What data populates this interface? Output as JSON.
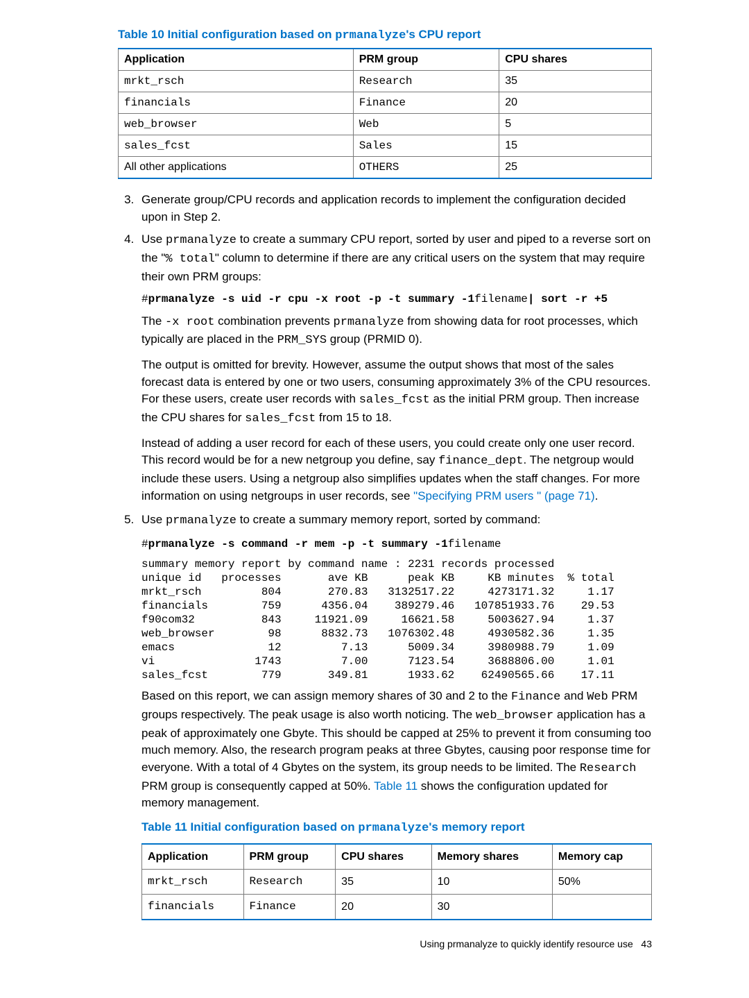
{
  "table10": {
    "title_prefix": "Table 10 Initial configuration based on ",
    "title_mono": "prmanalyze",
    "title_suffix": "'s CPU report",
    "headers": [
      "Application",
      "PRM group",
      "CPU shares"
    ],
    "rows": [
      {
        "app": "mrkt_rsch",
        "group": "Research",
        "shares": "35",
        "mono": true
      },
      {
        "app": "financials",
        "group": "Finance",
        "shares": "20",
        "mono": true
      },
      {
        "app": "web_browser",
        "group": "Web",
        "shares": "5",
        "mono": true
      },
      {
        "app": "sales_fcst",
        "group": "Sales",
        "shares": "15",
        "mono": true
      },
      {
        "app": "All other applications",
        "group": "OTHERS",
        "shares": "25",
        "mono": false
      }
    ]
  },
  "step3": "Generate group/CPU records and application records to implement the configuration decided upon in Step 2.",
  "step4": {
    "intro_a": "Use ",
    "intro_mono1": "prmanalyze",
    "intro_b": " to create a summary CPU report, sorted by user and piped to a reverse sort on the \"",
    "intro_mono2": "% total",
    "intro_c": "\" column to determine if there are any critical users on the system that may require their own PRM groups:",
    "cmd1_a": "#",
    "cmd1_b": "prmanalyze -s uid -r cpu -x root -p -t summary -1",
    "cmd1_c": "filename",
    "cmd1_d": "| sort -r +5",
    "para2_a": "The ",
    "para2_mono1": "-x root",
    "para2_b": " combination prevents ",
    "para2_mono2": "prmanalyze",
    "para2_c": " from showing data for root processes, which typically are placed in the ",
    "para2_mono3": "PRM_SYS",
    "para2_d": " group (PRMID 0).",
    "para3_a": "The output is omitted for brevity. However, assume the output shows that most of the sales forecast data is entered by one or two users, consuming approximately 3% of the CPU resources. For these users, create user records with ",
    "para3_mono1": "sales_fcst",
    "para3_b": " as the initial PRM group. Then increase the CPU shares for ",
    "para3_mono2": "sales_fcst",
    "para3_c": " from 15 to 18.",
    "para4_a": "Instead of adding a user record for each of these users, you could create only one user record. This record would be for a new netgroup you define, say ",
    "para4_mono1": "finance_dept",
    "para4_b": ". The netgroup would include these users. Using a netgroup also simplifies updates when the staff changes. For more information on using netgroups in user records, see ",
    "para4_link": "\"Specifying PRM users \" (page 71)",
    "para4_c": "."
  },
  "step5": {
    "intro_a": "Use ",
    "intro_mono1": "prmanalyze",
    "intro_b": " to create a summary memory report, sorted by command:",
    "cmd_a": "#",
    "cmd_b": "prmanalyze -s command -r mem -p -t summary -1",
    "cmd_c": "filename",
    "report": "summary memory report by command name : 2231 records processed\nunique id   processes       ave KB      peak KB     KB minutes  % total\nmrkt_rsch         804       270.83   3132517.22     4273171.32     1.17\nfinancials        759      4356.04    389279.46   107851933.76    29.53\nf90com32          843     11921.09     16621.58     5003627.94     1.37\nweb_browser        98      8832.73   1076302.48     4930582.36     1.35\nemacs              12         7.13      5009.34     3980988.79     1.09\nvi               1743         7.00      7123.54     3688806.00     1.01\nsales_fcst        779       349.81      1933.62    62490565.66    17.11",
    "para_a": "Based on this report, we can assign memory shares of 30 and 2 to the ",
    "para_mono1": "Finance",
    "para_b": " and ",
    "para_mono2": "Web",
    "para_c": " PRM groups respectively. The peak usage is also worth noticing. The ",
    "para_mono3": "web_browser",
    "para_d": " application has a peak of approximately one Gbyte. This should be capped at 25% to prevent it from consuming too much memory. Also, the research program peaks at three Gbytes, causing poor response time for everyone. With a total of 4 Gbytes on the system, its group needs to be limited. The ",
    "para_mono4": "Research",
    "para_e": " PRM group is consequently capped at 50%. ",
    "para_link": "Table 11",
    "para_f": " shows the configuration updated for memory management."
  },
  "table11": {
    "title_prefix": "Table 11 Initial configuration based on ",
    "title_mono": "prmanalyze",
    "title_suffix": "'s memory report",
    "headers": [
      "Application",
      "PRM group",
      "CPU shares",
      "Memory shares",
      "Memory cap"
    ],
    "rows": [
      {
        "app": "mrkt_rsch",
        "group": "Research",
        "cpu": "35",
        "mem": "10",
        "cap": "50%"
      },
      {
        "app": "financials",
        "group": "Finance",
        "cpu": "20",
        "mem": "30",
        "cap": ""
      }
    ]
  },
  "footer": {
    "text": "Using prmanalyze to quickly identify resource use",
    "page": "43"
  },
  "chart_data": [
    {
      "type": "table",
      "title": "Table 10 Initial configuration based on prmanalyze's CPU report",
      "columns": [
        "Application",
        "PRM group",
        "CPU shares"
      ],
      "rows": [
        [
          "mrkt_rsch",
          "Research",
          35
        ],
        [
          "financials",
          "Finance",
          20
        ],
        [
          "web_browser",
          "Web",
          5
        ],
        [
          "sales_fcst",
          "Sales",
          15
        ],
        [
          "All other applications",
          "OTHERS",
          25
        ]
      ]
    },
    {
      "type": "table",
      "title": "summary memory report by command name : 2231 records processed",
      "columns": [
        "unique id",
        "processes",
        "ave KB",
        "peak KB",
        "KB minutes",
        "% total"
      ],
      "rows": [
        [
          "mrkt_rsch",
          804,
          270.83,
          3132517.22,
          4273171.32,
          1.17
        ],
        [
          "financials",
          759,
          4356.04,
          389279.46,
          107851933.76,
          29.53
        ],
        [
          "f90com32",
          843,
          11921.09,
          16621.58,
          5003627.94,
          1.37
        ],
        [
          "web_browser",
          98,
          8832.73,
          1076302.48,
          4930582.36,
          1.35
        ],
        [
          "emacs",
          12,
          7.13,
          5009.34,
          3980988.79,
          1.09
        ],
        [
          "vi",
          1743,
          7.0,
          7123.54,
          3688806.0,
          1.01
        ],
        [
          "sales_fcst",
          779,
          349.81,
          1933.62,
          62490565.66,
          17.11
        ]
      ]
    },
    {
      "type": "table",
      "title": "Table 11 Initial configuration based on prmanalyze's memory report",
      "columns": [
        "Application",
        "PRM group",
        "CPU shares",
        "Memory shares",
        "Memory cap"
      ],
      "rows": [
        [
          "mrkt_rsch",
          "Research",
          35,
          10,
          "50%"
        ],
        [
          "financials",
          "Finance",
          20,
          30,
          ""
        ]
      ]
    }
  ]
}
